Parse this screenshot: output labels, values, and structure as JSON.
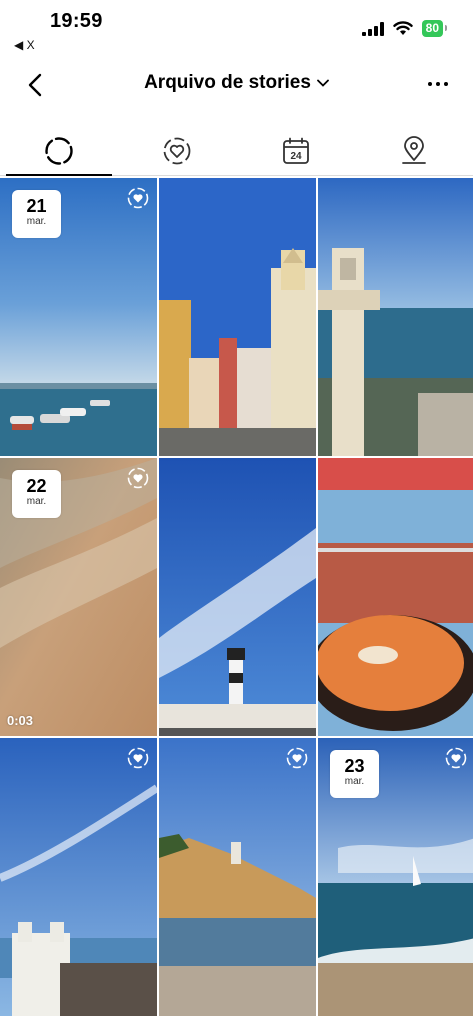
{
  "status_bar": {
    "time": "19:59",
    "back_app": "◀ X",
    "battery": "80"
  },
  "header": {
    "title": "Arquivo de stories",
    "icons": [
      "back-arrow-icon",
      "chevron-down-icon",
      "more-options-icon"
    ]
  },
  "tabs": [
    {
      "name": "stories-archive",
      "icon": "dashed-circle-icon",
      "active": true
    },
    {
      "name": "highlights",
      "icon": "heart-circle-icon",
      "active": false
    },
    {
      "name": "calendar",
      "icon": "calendar-icon",
      "active": false
    },
    {
      "name": "map",
      "icon": "location-pin-icon",
      "active": false
    }
  ],
  "tiles": [
    {
      "day": "21",
      "month": "mar.",
      "scene": "harbor-boats",
      "highlight": true
    },
    {
      "scene": "colonial-street",
      "highlight": false
    },
    {
      "scene": "elevator-tower",
      "highlight": false
    },
    {
      "day": "22",
      "month": "mar.",
      "scene": "beach-sand",
      "highlight": true,
      "duration": "0:03"
    },
    {
      "scene": "lighthouse-sky",
      "highlight": false
    },
    {
      "scene": "restaurant-soup",
      "highlight": false
    },
    {
      "scene": "church-sky",
      "highlight": true
    },
    {
      "scene": "hillside-town",
      "highlight": true
    },
    {
      "day": "23",
      "month": "mar.",
      "scene": "sea-sailboat",
      "highlight": true
    }
  ],
  "colors": {
    "battery": "#34c759",
    "active_tab_indicator": "#000000"
  }
}
